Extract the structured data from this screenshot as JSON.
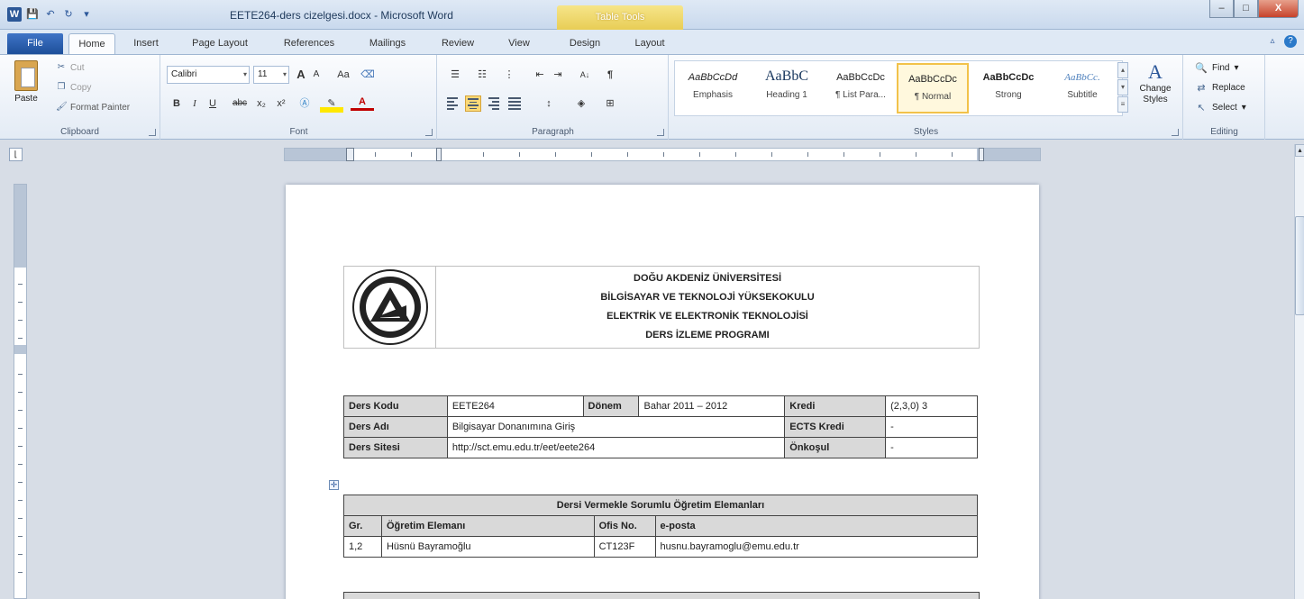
{
  "window": {
    "title": "EETE264-ders cizelgesi.docx - Microsoft Word",
    "contextual_tab": "Table Tools",
    "controls": {
      "minimize": "–",
      "maximize": "□",
      "close": "X"
    }
  },
  "quick_access": {
    "app_icon": "W",
    "save": "💾",
    "undo": "↶",
    "redo": "↻",
    "dropdown": "▾"
  },
  "tabs": {
    "file": "File",
    "home": "Home",
    "insert": "Insert",
    "page_layout": "Page Layout",
    "references": "References",
    "mailings": "Mailings",
    "review": "Review",
    "view": "View",
    "design": "Design",
    "layout": "Layout"
  },
  "clipboard": {
    "paste": "Paste",
    "cut": "Cut",
    "copy": "Copy",
    "format_painter": "Format Painter",
    "label": "Clipboard"
  },
  "font": {
    "name": "Calibri",
    "size": "11",
    "grow": "A",
    "shrink": "A",
    "case": "Aa",
    "bold": "B",
    "italic": "I",
    "underline": "U",
    "strike": "abc",
    "subscript": "x₂",
    "superscript": "x²",
    "font_color": "A",
    "label": "Font"
  },
  "paragraph": {
    "sort": "A↓",
    "pilcrow": "¶",
    "label": "Paragraph"
  },
  "styles": {
    "label": "Styles",
    "items": [
      {
        "sample": "AaBbCcDd",
        "name": "Emphasis"
      },
      {
        "sample": "AaBbC",
        "name": "Heading 1"
      },
      {
        "sample": "AaBbCcDc",
        "name": "¶ List Para..."
      },
      {
        "sample": "AaBbCcDc",
        "name": "¶ Normal"
      },
      {
        "sample": "AaBbCcDc",
        "name": "Strong"
      },
      {
        "sample": "AaBbCc.",
        "name": "Subtitle"
      }
    ],
    "change_styles": "Change Styles"
  },
  "editing": {
    "find": "Find",
    "replace": "Replace",
    "select": "Select",
    "label": "Editing"
  },
  "document": {
    "header_lines": [
      "DOĞU AKDENİZ ÜNİVERSİTESİ",
      "BİLGİSAYAR VE TEKNOLOJİ YÜKSEKOKULU",
      "ELEKTRİK VE ELEKTRONİK TEKNOLOJİSİ",
      "DERS İZLEME PROGRAMI"
    ],
    "course_table": {
      "rows": [
        [
          "Ders Kodu",
          "EETE264",
          "Dönem",
          "Bahar 2011 – 2012",
          "Kredi",
          "(2,3,0) 3"
        ],
        [
          "Ders Adı",
          "Bilgisayar Donanımına Giriş",
          "",
          "",
          "ECTS Kredi",
          "-"
        ],
        [
          "Ders Sitesi",
          "http://sct.emu.edu.tr/eet/eete264",
          "",
          "",
          "Önkoşul",
          "-"
        ]
      ]
    },
    "instructor_table": {
      "title": "Dersi Vermekle Sorumlu Öğretim Elemanları",
      "headers": [
        "Gr.",
        "Öğretim Elemanı",
        "Ofis No.",
        "e-posta"
      ],
      "rows": [
        [
          "1,2",
          "Hüsnü Bayramoğlu",
          "CT123F",
          "husnu.bayramoglu@emu.edu.tr"
        ]
      ]
    }
  },
  "colors": {
    "file_tab": "#2b5797",
    "table_tools": "#e8cd55",
    "table_header_bg": "#d9d9d9",
    "selected_style": "#f2c24a"
  }
}
